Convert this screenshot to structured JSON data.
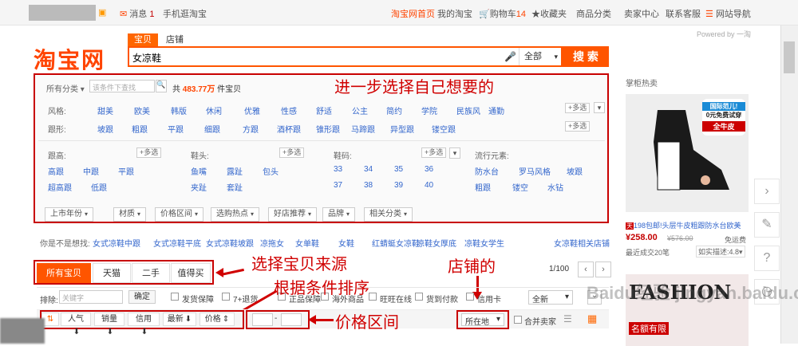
{
  "topbar": {
    "messages": "消息",
    "messages_count": "1",
    "mobile": "手机逛淘宝",
    "home": "淘宝网首页",
    "my_taobao": "我的淘宝",
    "cart": "购物车",
    "cart_count": "14",
    "favorites": "收藏夹",
    "categories": "商品分类",
    "seller_center": "卖家中心",
    "service": "联系客服",
    "site_nav": "网站导航"
  },
  "logo": "淘宝网",
  "search": {
    "tab_item": "宝贝",
    "tab_shop": "店铺",
    "value": "女凉鞋",
    "scope": "全部",
    "button": "搜 索",
    "powered": "Powered by 一淘"
  },
  "filter": {
    "all_categories": "所有分类",
    "search_placeholder": "该条件下查找",
    "total_prefix": "共",
    "total": "483.77万",
    "total_suffix": "件宝贝",
    "style_label": "风格:",
    "styles": [
      "甜美",
      "欧美",
      "韩版",
      "休闲",
      "优雅",
      "性感",
      "舒适",
      "公主",
      "简约",
      "学院",
      "民族风",
      "通勤"
    ],
    "heel_label": "跟形:",
    "heel_shapes": [
      "坡跟",
      "粗跟",
      "平跟",
      "细跟",
      "方跟",
      "酒杯跟",
      "锥形跟",
      "马蹄跟",
      "异型跟",
      "镂空跟"
    ],
    "more_select": "+多选",
    "heel_height_label": "跟高:",
    "heel_heights": [
      "高跟",
      "中跟",
      "平跟",
      "超高跟",
      "低跟"
    ],
    "toe_label": "鞋头:",
    "toes": [
      "鱼嘴",
      "露趾",
      "包头",
      "夹趾",
      "套趾"
    ],
    "size_label": "鞋码:",
    "sizes": [
      "33",
      "34",
      "35",
      "36",
      "37",
      "38",
      "39",
      "40"
    ],
    "trend_label": "流行元素:",
    "trends": [
      "防水台",
      "罗马风格",
      "坡跟",
      "粗跟",
      "镂空",
      "水钻"
    ],
    "selects": [
      "上市年份",
      "材质",
      "价格区间",
      "选购热点",
      "好店推荐",
      "品牌",
      "相关分类"
    ]
  },
  "annotations": {
    "refine": "进一步选择自己想要的",
    "source": "选择宝贝来源",
    "sort": "根据条件排序",
    "shop": "店铺的",
    "price": "价格区间"
  },
  "related": {
    "label": "你是不是想找:",
    "items": [
      "女式凉鞋中跟",
      "女式凉鞋平底",
      "女式凉鞋坡跟",
      "凉拖女",
      "女单鞋",
      "女鞋",
      "红蜻蜓女凉鞋",
      "凉鞋女厚底",
      "凉鞋女学生"
    ],
    "shop_link": "女凉鞋相关店铺"
  },
  "tabs": [
    "所有宝贝",
    "天猫",
    "二手",
    "值得买"
  ],
  "pager": "1/100",
  "frow2": {
    "exclude_label": "排除:",
    "exclude_placeholder": "关键字",
    "confirm": "确定",
    "checks": [
      "发货保障",
      "7+退货",
      "正品保障",
      "海外商品",
      "旺旺在线",
      "货到付款",
      "信用卡"
    ],
    "scope": "全新"
  },
  "sortrow": {
    "sorts": [
      "人气",
      "销量",
      "信用",
      "最新",
      "价格"
    ],
    "location": "所在地",
    "merge": "合并卖家"
  },
  "right": {
    "hot_title": "掌柜热卖",
    "p1_badge": "国际范儿!",
    "p1_trial": "0元免费试穿",
    "p1_leather": "全牛皮",
    "p1_title": "198包邮!头层牛皮粗跟防水台欧美",
    "p1_price": "¥258.00",
    "p1_orig": "¥576.00",
    "p1_ship": "免运费",
    "p1_recent": "最近成交20笔",
    "p1_rate": "如实描述:4.8",
    "p2_brand": "FASHION",
    "p2_tag": "名额有限"
  },
  "watermark": "Baidu经验 jingyan.baidu.com",
  "colors": {
    "accent": "#ff5500",
    "annotation": "#d00000",
    "link": "#3366cc"
  }
}
